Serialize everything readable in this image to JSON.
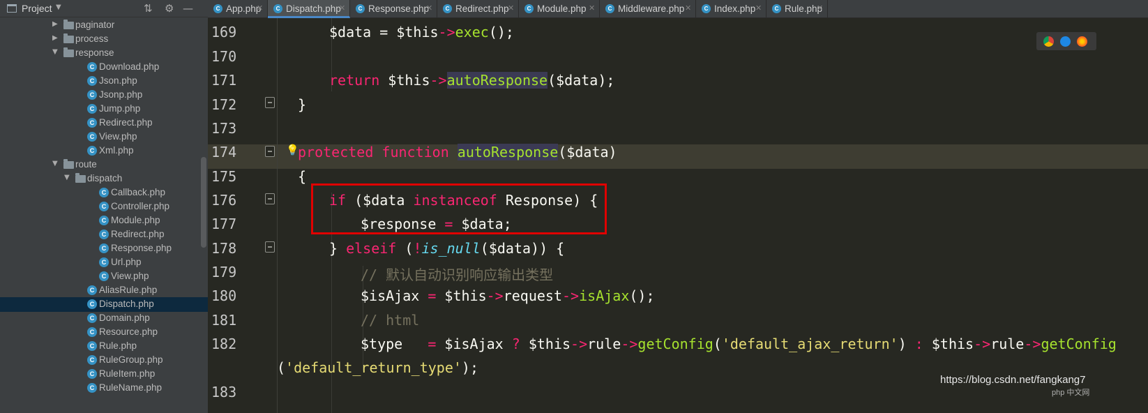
{
  "sidebar": {
    "title": "Project",
    "toolbar": [
      "collapse-icon",
      "gear-icon",
      "minimize-icon"
    ],
    "items": [
      {
        "label": "paginator",
        "type": "folder",
        "expanded": false,
        "depth": 1
      },
      {
        "label": "process",
        "type": "folder",
        "expanded": false,
        "depth": 1
      },
      {
        "label": "response",
        "type": "folder",
        "expanded": true,
        "depth": 1
      },
      {
        "label": "Download.php",
        "type": "file",
        "depth": 2
      },
      {
        "label": "Json.php",
        "type": "file",
        "depth": 2
      },
      {
        "label": "Jsonp.php",
        "type": "file",
        "depth": 2
      },
      {
        "label": "Jump.php",
        "type": "file",
        "depth": 2
      },
      {
        "label": "Redirect.php",
        "type": "file",
        "depth": 2
      },
      {
        "label": "View.php",
        "type": "file",
        "depth": 2
      },
      {
        "label": "Xml.php",
        "type": "file",
        "depth": 2
      },
      {
        "label": "route",
        "type": "folder",
        "expanded": true,
        "depth": 1
      },
      {
        "label": "dispatch",
        "type": "folder",
        "expanded": true,
        "depth": 2
      },
      {
        "label": "Callback.php",
        "type": "file",
        "depth": 3
      },
      {
        "label": "Controller.php",
        "type": "file",
        "depth": 3
      },
      {
        "label": "Module.php",
        "type": "file",
        "depth": 3
      },
      {
        "label": "Redirect.php",
        "type": "file",
        "depth": 3
      },
      {
        "label": "Response.php",
        "type": "file",
        "depth": 3
      },
      {
        "label": "Url.php",
        "type": "file",
        "depth": 3
      },
      {
        "label": "View.php",
        "type": "file",
        "depth": 3
      },
      {
        "label": "AliasRule.php",
        "type": "file",
        "depth": 2
      },
      {
        "label": "Dispatch.php",
        "type": "file",
        "depth": 2,
        "selected": true
      },
      {
        "label": "Domain.php",
        "type": "file",
        "depth": 2
      },
      {
        "label": "Resource.php",
        "type": "file",
        "depth": 2
      },
      {
        "label": "Rule.php",
        "type": "file",
        "depth": 2
      },
      {
        "label": "RuleGroup.php",
        "type": "file",
        "depth": 2
      },
      {
        "label": "RuleItem.php",
        "type": "file",
        "depth": 2
      },
      {
        "label": "RuleName.php",
        "type": "file",
        "depth": 2
      }
    ]
  },
  "tabs": [
    {
      "label": "App.php",
      "active": false
    },
    {
      "label": "Dispatch.php",
      "active": true
    },
    {
      "label": "Response.php",
      "active": false
    },
    {
      "label": "Redirect.php",
      "active": false
    },
    {
      "label": "Module.php",
      "active": false
    },
    {
      "label": "Middleware.php",
      "active": false
    },
    {
      "label": "Index.php",
      "active": false
    },
    {
      "label": "Rule.php",
      "active": false
    }
  ],
  "editor": {
    "line_numbers": [
      "169",
      "170",
      "171",
      "172",
      "173",
      "174",
      "175",
      "176",
      "177",
      "178",
      "179",
      "180",
      "181",
      "182",
      "",
      "183"
    ],
    "current_line": "174",
    "browser_icons": [
      "chrome-icon",
      "edge-icon",
      "firefox-icon"
    ],
    "watermark": "https://blog.csdn.net/fangkang7",
    "watermark_small": "php 中文网",
    "colors": {
      "keyword": "#f92672",
      "function": "#a6e22e",
      "string": "#e6db74",
      "comment": "#75715e",
      "builtin": "#66d9ef",
      "highlight_box": "#e00000"
    }
  }
}
